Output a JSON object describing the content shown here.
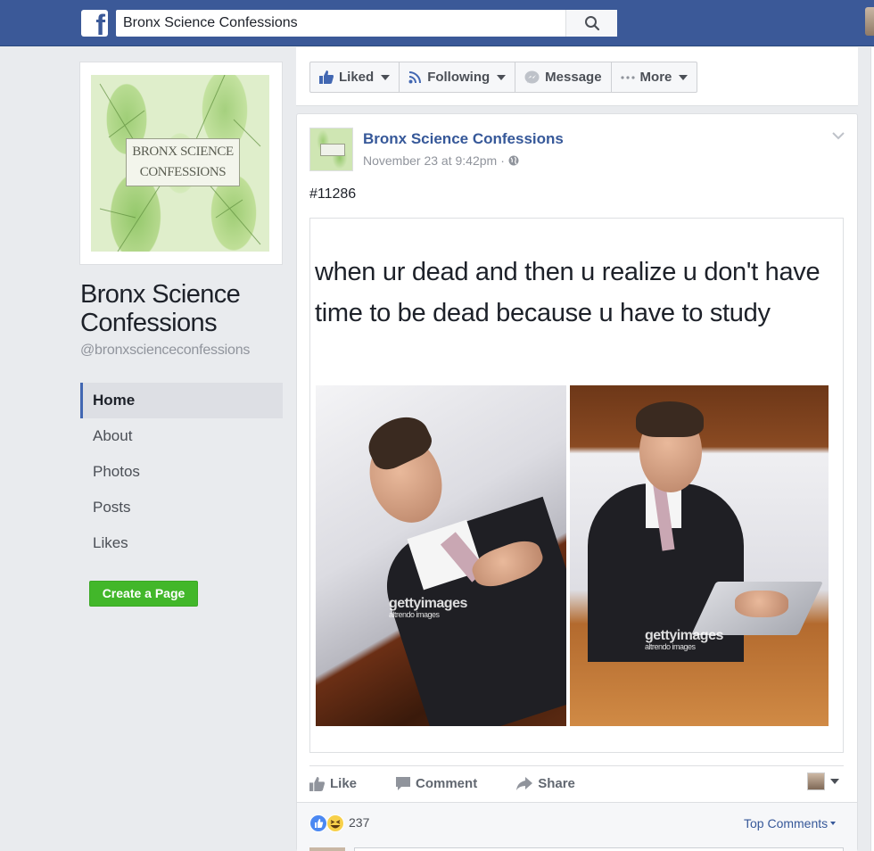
{
  "topbar": {
    "search_value": "Bronx Science Confessions",
    "logo_letter": "f"
  },
  "page": {
    "cover_line1": "BRONX SCIENCE",
    "cover_line2": "CONFESSIONS",
    "name": "Bronx Science Confessions",
    "handle": "@bronxscienceconfessions"
  },
  "nav": {
    "items": [
      {
        "label": "Home"
      },
      {
        "label": "About"
      },
      {
        "label": "Photos"
      },
      {
        "label": "Posts"
      },
      {
        "label": "Likes"
      }
    ],
    "create_page_label": "Create a Page"
  },
  "actions": {
    "liked": "Liked",
    "following": "Following",
    "message": "Message",
    "more": "More"
  },
  "post": {
    "author": "Bronx Science Confessions",
    "time": "November 23 at 9:42pm",
    "separator": "·",
    "number": "#11286",
    "meme_caption": "when ur dead and then u realize u don't have time to be dead because u have to study",
    "watermark_brand": "gettyimages",
    "watermark_sub": "altrendo images"
  },
  "reactions": {
    "like": "Like",
    "comment": "Comment",
    "share": "Share",
    "count": "237",
    "top_comments": "Top Comments"
  },
  "colors": {
    "brand_blue": "#3b5998",
    "link_blue": "#365899",
    "green_button": "#42b72a"
  }
}
